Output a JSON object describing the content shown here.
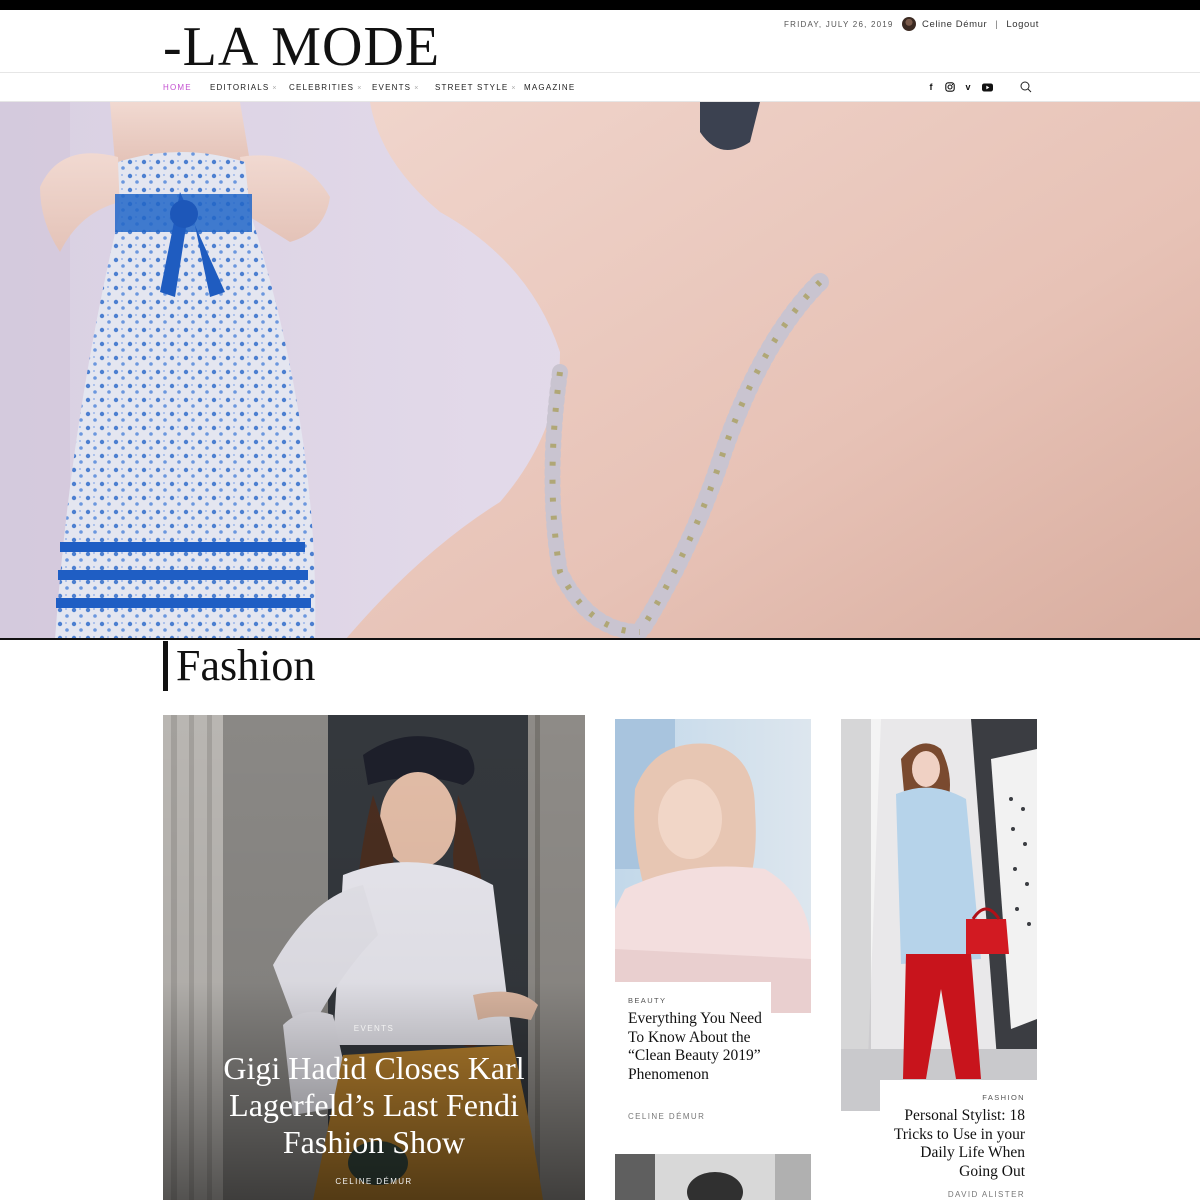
{
  "brand": {
    "logo": "-LA MODE"
  },
  "header": {
    "date": "FRIDAY, JULY 26, 2019",
    "user_name": "Celine Démur",
    "separator": "|",
    "logout": "Logout"
  },
  "nav": {
    "items": [
      {
        "label": "HOME",
        "active": true,
        "has_submenu": false
      },
      {
        "label": "EDITORIALS",
        "active": false,
        "has_submenu": true
      },
      {
        "label": "CELEBRITIES",
        "active": false,
        "has_submenu": true
      },
      {
        "label": "EVENTS",
        "active": false,
        "has_submenu": true
      },
      {
        "label": "STREET STYLE",
        "active": false,
        "has_submenu": true
      },
      {
        "label": "MAGAZINE",
        "active": false,
        "has_submenu": false
      }
    ],
    "submenu_glyph": "×",
    "social_icons": [
      "facebook-icon",
      "instagram-icon",
      "vimeo-icon",
      "youtube-icon"
    ],
    "social_glyphs": [
      "f",
      "◎",
      "v",
      "▶"
    ],
    "search_icon": "search-icon",
    "active_color": "#c34fd0"
  },
  "section": {
    "title": "Fashion"
  },
  "featured": {
    "category": "EVENTS",
    "title": "Gigi Hadid Closes Karl Lagerfeld’s Last Fendi Fashion Show",
    "author": "CELINE DÉMUR"
  },
  "posts": [
    {
      "category": "BEAUTY",
      "title": "Everything You Need To Know About the “Clean Beauty 2019” Phenomenon",
      "author": "CELINE DÉMUR"
    },
    {
      "category": "FASHION",
      "title": "Personal Stylist: 18 Tricks to Use in your Daily Life When Going Out",
      "author": "DAVID ALISTER"
    }
  ],
  "colors": {
    "accent": "#c34fd0",
    "text": "#111111",
    "topbar": "#000000"
  }
}
